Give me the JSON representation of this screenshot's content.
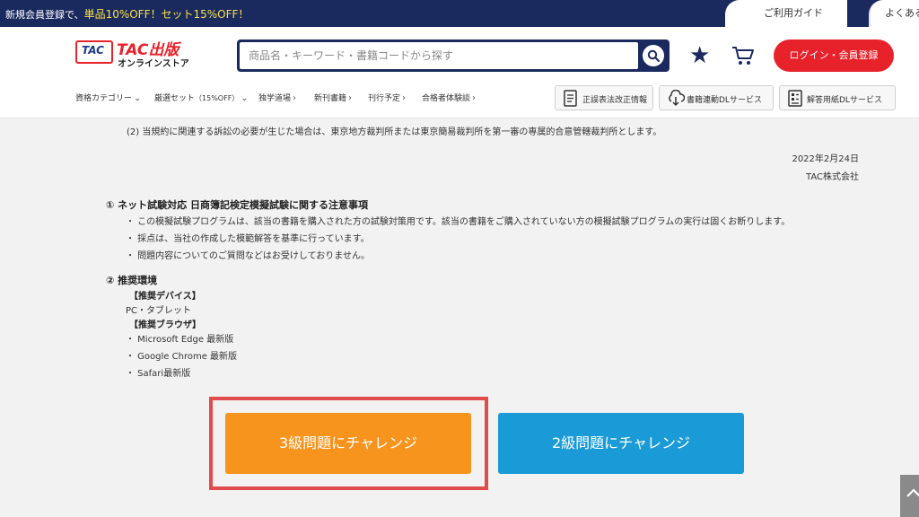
{
  "topbar": {
    "promo_prefix": "新規会員登録で、",
    "promo_highlight": "単品10%OFF！セット15%OFF！",
    "guide_link": "ご利用ガイド",
    "faq_link": "よくある"
  },
  "header": {
    "logo_mark": "TAC",
    "logo_text": "TAC出版",
    "logo_sub": "オンラインストア",
    "search_placeholder": "商品名・キーワード・書籍コードから探す",
    "login_label": "ログイン・会員登録",
    "icons": [
      "search-icon",
      "star-icon",
      "cart-icon"
    ]
  },
  "nav": {
    "items": [
      {
        "label": "資格カテゴリー",
        "suffix": "⌄"
      },
      {
        "label": "厳選セット",
        "small": "（15%OFF）",
        "suffix": "⌄"
      },
      {
        "label": "独学道場",
        "suffix": "›"
      },
      {
        "label": "新刊書籍",
        "suffix": "›"
      },
      {
        "label": "刊行予定",
        "suffix": "›"
      },
      {
        "label": "合格者体験談",
        "suffix": "›"
      }
    ],
    "services": [
      {
        "label": "正誤表法改正情報",
        "icon": "document-list-icon"
      },
      {
        "label": "書籍連動DLサービス",
        "icon": "cloud-download-icon"
      },
      {
        "label": "解答用紙DLサービス",
        "icon": "answer-sheet-icon"
      }
    ]
  },
  "main": {
    "jurisdiction_text": "(2) 当規約に関連する訴訟の必要が生じた場合は、東京地方裁判所または東京簡易裁判所を第一審の専属的合意管轄裁判所とします。",
    "date": "2022年2月24日",
    "company": "TAC株式会社",
    "section1": {
      "title": "① ネット試験対応 日商簿記検定模擬試験に関する注意事項",
      "bullets": [
        "・ この模擬試験プログラムは、該当の書籍を購入された方の試験対策用です。該当の書籍をご購入されていない方の模擬試験プログラムの実行は固くお断りします。",
        "・ 採点は、当社の作成した模範解答を基準に行っています。",
        "・ 問題内容についてのご質問などはお受けしておりません。"
      ]
    },
    "section2": {
      "title": "② 推奨環境",
      "device_head": "【推奨デバイス】",
      "device_value": "PC・タブレット",
      "browser_head": "【推奨ブラウザ】",
      "browsers": [
        "・ Microsoft Edge 最新版",
        "・ Google Chrome 最新版",
        "・ Safari最新版"
      ]
    },
    "buttons": {
      "level3": "3級問題にチャレンジ",
      "level2": "2級問題にチャレンジ"
    }
  },
  "colors": {
    "navy": "#1a2a5e",
    "brand_red": "#e8222b",
    "orange": "#f7941d",
    "blue": "#1a9bd7",
    "highlight": "#e04b4b"
  }
}
